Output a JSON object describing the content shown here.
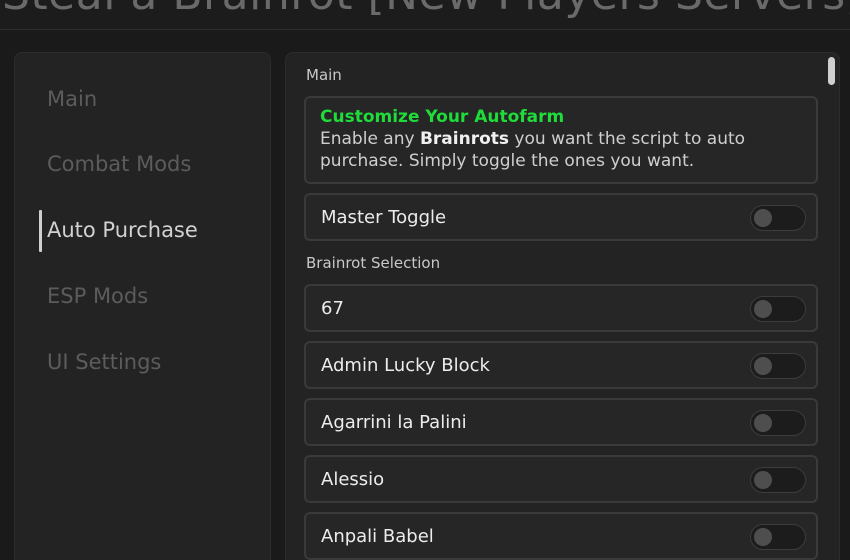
{
  "window": {
    "title": "Steal a Brainrot [New Players Servers]"
  },
  "sidebar": {
    "items": [
      {
        "label": "Main",
        "active": false
      },
      {
        "label": "Combat Mods",
        "active": false
      },
      {
        "label": "Auto Purchase",
        "active": true
      },
      {
        "label": "ESP Mods",
        "active": false
      },
      {
        "label": "UI Settings",
        "active": false
      }
    ]
  },
  "main": {
    "section_title": "Main",
    "info": {
      "title": "Customize Your Autofarm",
      "desc_prefix": "Enable any ",
      "desc_bold": "Brainrots",
      "desc_line1_rest": " you want the script to auto",
      "desc_line2": "purchase. Simply toggle the ones you want.",
      "title_color": "#1fdc3a"
    },
    "master_toggle": {
      "label": "Master Toggle",
      "on": false
    },
    "selection_title": "Brainrot Selection",
    "brainrots": [
      {
        "label": "67",
        "on": false
      },
      {
        "label": "Admin Lucky Block",
        "on": false
      },
      {
        "label": "Agarrini la Palini",
        "on": false
      },
      {
        "label": "Alessio",
        "on": false
      },
      {
        "label": "Anpali Babel",
        "on": false
      }
    ]
  }
}
